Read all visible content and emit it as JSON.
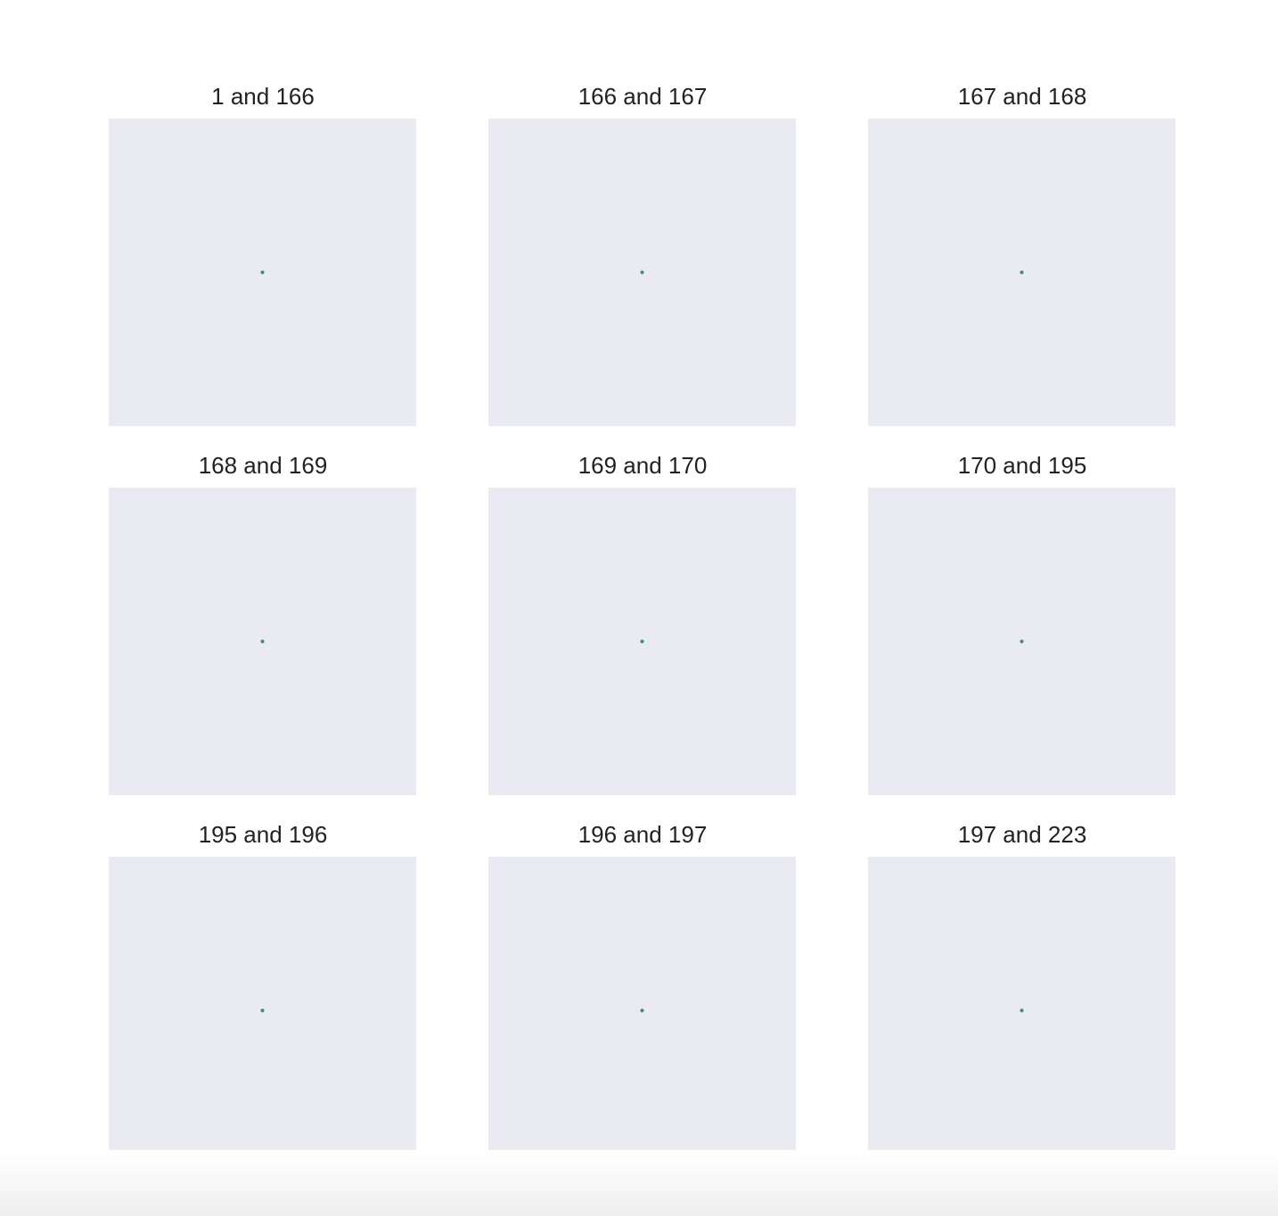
{
  "chart_data": [
    {
      "type": "scatter",
      "title": "1 and 166",
      "points": [
        [
          0,
          0
        ]
      ],
      "grid": false
    },
    {
      "type": "scatter",
      "title": "166 and 167",
      "points": [
        [
          0,
          0
        ]
      ],
      "grid": false
    },
    {
      "type": "scatter",
      "title": "167 and 168",
      "points": [
        [
          0,
          0
        ]
      ],
      "grid": false
    },
    {
      "type": "scatter",
      "title": "168 and 169",
      "points": [
        [
          0,
          0
        ]
      ],
      "grid": false
    },
    {
      "type": "scatter",
      "title": "169 and 170",
      "points": [
        [
          0,
          0
        ]
      ],
      "grid": false
    },
    {
      "type": "scatter",
      "title": "170 and 195",
      "points": [
        [
          0,
          0
        ]
      ],
      "grid": false
    },
    {
      "type": "scatter",
      "title": "195 and 196",
      "points": [
        [
          0,
          0
        ]
      ],
      "grid": false
    },
    {
      "type": "scatter",
      "title": "196 and 197",
      "points": [
        [
          0,
          0
        ]
      ],
      "grid": false
    },
    {
      "type": "scatter",
      "title": "197 and 223",
      "points": [
        [
          0,
          0
        ]
      ],
      "grid": false
    }
  ],
  "colors": {
    "plot_background": "#eaeaf2",
    "point": "#3a8a7e"
  }
}
